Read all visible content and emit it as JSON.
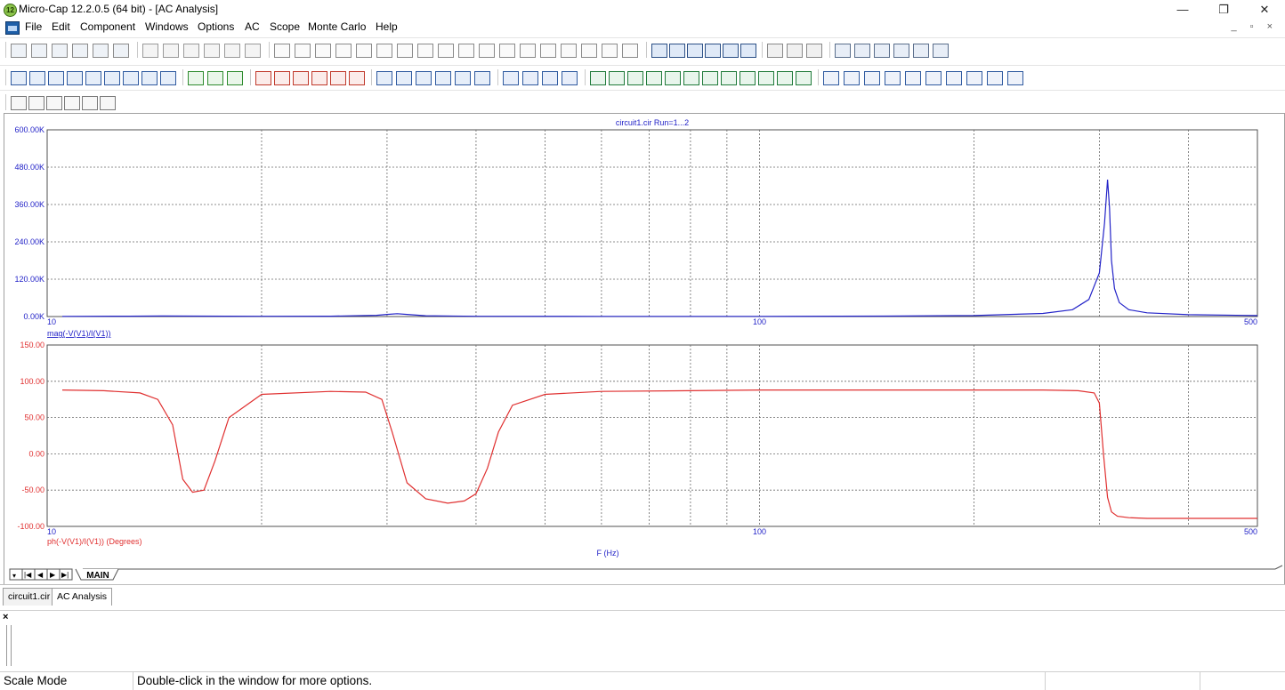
{
  "window": {
    "title": "Micro-Cap 12.2.0.5 (64 bit) - [AC Analysis]",
    "app_icon_text": "12",
    "minimize": "—",
    "restore": "❐",
    "close": "✕"
  },
  "menu": [
    {
      "label": "File"
    },
    {
      "label": "Edit"
    },
    {
      "label": "Component"
    },
    {
      "label": "Windows"
    },
    {
      "label": "Options"
    },
    {
      "label": "AC"
    },
    {
      "label": "Scope"
    },
    {
      "label": "Monte Carlo"
    },
    {
      "label": "Help"
    }
  ],
  "mdi_controls": "_ ▫ ×",
  "plot_title": "circuit1.cir Run=1...2",
  "top_plot": {
    "ylabel": "mag(-V(V1)/I(V1))",
    "y_ticks": [
      "600.00K",
      "480.00K",
      "360.00K",
      "240.00K",
      "120.00K",
      "0.00K"
    ],
    "x_ticks": [
      "10",
      "100",
      "500"
    ],
    "trace_color": "#2323c8"
  },
  "bottom_plot": {
    "ylabel": "ph(-V(V1)/I(V1)) (Degrees)",
    "y_ticks": [
      "150.00",
      "100.00",
      "50.00",
      "0.00",
      "-50.00",
      "-100.00"
    ],
    "x_ticks": [
      "10",
      "100",
      "500"
    ],
    "xlabel": "F (Hz)",
    "trace_color": "#e03030"
  },
  "chart_data": [
    {
      "type": "line",
      "title": "circuit1.cir Run=1...2",
      "ylabel": "mag(-V(V1)/I(V1))",
      "x_scale": "log",
      "xlim": [
        10,
        500
      ],
      "ylim": [
        0,
        600000
      ],
      "grid": true,
      "series": [
        {
          "name": "mag(-V(V1)/I(V1))",
          "x": [
            10.5,
            13,
            14.5,
            16,
            20,
            25,
            29,
            30,
            31,
            32,
            34,
            40,
            60,
            100,
            150,
            200,
            250,
            275,
            290,
            300,
            305,
            308,
            310,
            312,
            315,
            320,
            330,
            350,
            400,
            500
          ],
          "y": [
            500,
            1200,
            1800,
            1500,
            800,
            1200,
            4000,
            7000,
            9000,
            7000,
            2500,
            1000,
            600,
            700,
            1500,
            3000,
            10000,
            22000,
            55000,
            140000,
            300000,
            440000,
            350000,
            180000,
            90000,
            45000,
            22000,
            12000,
            6000,
            3000
          ]
        }
      ]
    },
    {
      "type": "line",
      "xlabel": "F (Hz)",
      "ylabel": "ph(-V(V1)/I(V1)) (Degrees)",
      "x_scale": "log",
      "xlim": [
        10,
        500
      ],
      "ylim": [
        -100,
        150
      ],
      "grid": true,
      "series": [
        {
          "name": "ph(-V(V1)/I(V1)) (Degrees)",
          "x": [
            10.5,
            12,
            13.5,
            14.3,
            15,
            15.5,
            16,
            16.6,
            17.2,
            18,
            20,
            25,
            28,
            29.5,
            30.5,
            32,
            34,
            36.5,
            38.5,
            40,
            41.5,
            43,
            45,
            50,
            60,
            80,
            100,
            150,
            200,
            250,
            280,
            295,
            300,
            304,
            308,
            312,
            318,
            330,
            350,
            400,
            500
          ],
          "y": [
            88,
            87,
            84,
            75,
            40,
            -35,
            -53,
            -50,
            -10,
            50,
            82,
            86,
            85,
            75,
            30,
            -40,
            -62,
            -68,
            -65,
            -55,
            -20,
            30,
            67,
            82,
            86,
            87,
            88,
            88,
            88,
            88,
            87,
            84,
            70,
            0,
            -60,
            -80,
            -86,
            -88,
            -89,
            -89,
            -89
          ]
        }
      ]
    }
  ],
  "sheet_tab": "MAIN",
  "doc_tabs": [
    {
      "label": "circuit1.cir"
    },
    {
      "label": "AC Analysis"
    }
  ],
  "output_close": "×",
  "status": {
    "mode": "Scale Mode",
    "hint": "Double-click in the window for more options."
  },
  "icons": [
    "new-icon",
    "open-icon",
    "save-icon",
    "print-icon",
    "undo-icon",
    "redo-icon",
    "cut-icon",
    "copy-icon",
    "paste-icon",
    "delete-icon",
    "ground-icon",
    "resistor-icon",
    "capacitor-icon",
    "inductor-icon",
    "diode-icon",
    "run-icon",
    "stop-icon",
    "pause-icon",
    "zoom-in-icon",
    "zoom-out-icon",
    "text-icon",
    "font-icon"
  ]
}
